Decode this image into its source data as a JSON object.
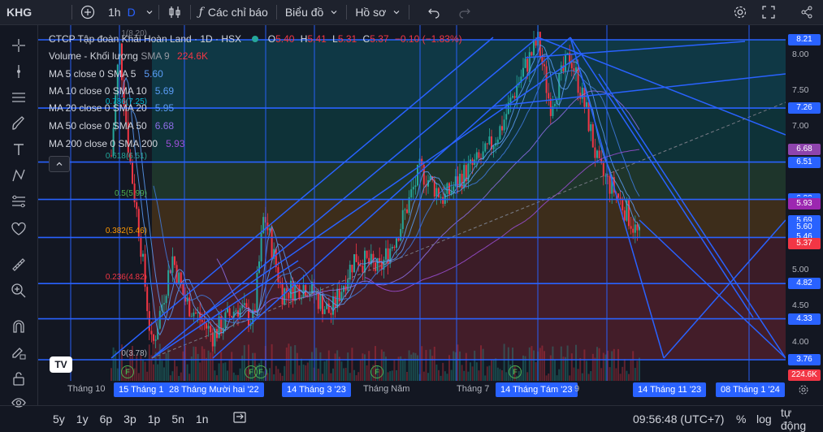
{
  "topbar": {
    "symbol": "KHG",
    "interval": "1h",
    "interval_type": "D",
    "indicators_label": "Các chỉ báo",
    "chart_type_label": "Biểu đồ",
    "profile_label": "Hồ sơ"
  },
  "legend": {
    "title": "CTCP Tập đoàn Khải Hoàn Land · 1D · HSX",
    "o_label": "O",
    "o": "5.40",
    "h_label": "H",
    "h": "5.41",
    "l_label": "L",
    "l": "5.31",
    "c_label": "C",
    "c": "5.37",
    "change": "−0.10 (−1.83%)",
    "volume_label": "Volume - Khối lượng",
    "volume_sma": "SMA 9",
    "volume_value": "224.6K",
    "ma": [
      {
        "label": "MA 5 close 0 SMA 5",
        "value": "5.60",
        "color": "#5b9cf6"
      },
      {
        "label": "MA 10 close 0 SMA 10",
        "value": "5.69",
        "color": "#5b9cf6"
      },
      {
        "label": "MA 20 close 0 SMA 20",
        "value": "5.95",
        "color": "#5b9cf6"
      },
      {
        "label": "MA 50 close 0 SMA 50",
        "value": "6.68",
        "color": "#8e6ee8"
      },
      {
        "label": "MA 200 close 0 SMA 200",
        "value": "5.93",
        "color": "#9c4fd6"
      }
    ]
  },
  "fib": [
    {
      "label": "0(3.78)",
      "price": 3.76
    },
    {
      "label": "0.236(4.82)",
      "price": 4.82
    },
    {
      "label": "0.382(5.46)",
      "price": 5.46
    },
    {
      "label": "0.5(5.99)",
      "price": 5.99
    },
    {
      "label": "0.618(6.51)",
      "price": 6.51
    },
    {
      "label": "0.786(7.25)",
      "price": 7.26
    },
    {
      "label": "1(8.20)",
      "price": 8.21
    }
  ],
  "price_ticks": [
    "8.00",
    "7.50",
    "7.00",
    "5.00",
    "4.50",
    "4.00"
  ],
  "price_labels": [
    {
      "text": "8.21",
      "price": 8.21,
      "color": "#2962ff"
    },
    {
      "text": "7.26",
      "price": 7.26,
      "color": "#2962ff"
    },
    {
      "text": "6.68",
      "price": 6.68,
      "color": "#8e44ad"
    },
    {
      "text": "6.51",
      "price": 6.51,
      "color": "#2962ff"
    },
    {
      "text": "6.00",
      "price": 6.0,
      "color": "#2962ff"
    },
    {
      "text": "5.95",
      "price": 5.95,
      "color": "#2962ff"
    },
    {
      "text": "5.93",
      "price": 5.93,
      "color": "#9c27b0"
    },
    {
      "text": "5.69",
      "price": 5.69,
      "color": "#2962ff"
    },
    {
      "text": "5.60",
      "price": 5.6,
      "color": "#2962ff"
    },
    {
      "text": "5.46",
      "price": 5.46,
      "color": "#2962ff"
    },
    {
      "text": "5.37",
      "price": 5.37,
      "color": "#f23645"
    },
    {
      "text": "4.82",
      "price": 4.82,
      "color": "#2962ff"
    },
    {
      "text": "4.33",
      "price": 4.33,
      "color": "#2962ff"
    },
    {
      "text": "3.76",
      "price": 3.76,
      "color": "#2962ff"
    },
    {
      "text": "224.6K",
      "price": 3.55,
      "color": "#f23645"
    }
  ],
  "time_labels": [
    "Tháng 10",
    "Tháng Năm",
    "Tháng 7",
    "9"
  ],
  "time_highlights": [
    "15 Tháng 1'",
    "28 Tháng Mười hai '22",
    "14 Tháng 3 '23",
    "14 Tháng Tám '23",
    "14 Tháng 11 '23",
    "08 Tháng 1 '24"
  ],
  "events": [
    "F",
    "F",
    "F",
    "F",
    "F"
  ],
  "bottombar": {
    "ranges": [
      "5y",
      "1y",
      "6p",
      "3p",
      "1p",
      "5n",
      "1n"
    ],
    "time": "09:56:48 (UTC+7)",
    "percent": "%",
    "log": "log",
    "auto": "tự động"
  }
}
